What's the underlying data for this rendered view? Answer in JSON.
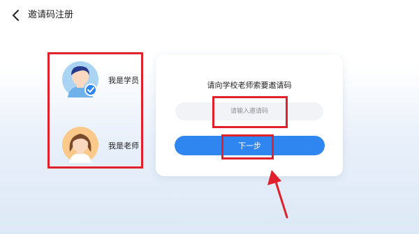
{
  "header": {
    "title": "邀请码注册",
    "back_icon": "chevron-left-icon"
  },
  "roles": [
    {
      "label": "我是学员",
      "selected": true,
      "avatar": "student-avatar",
      "badge_icon": "check-circle-icon"
    },
    {
      "label": "我是老师",
      "selected": false,
      "avatar": "teacher-avatar"
    }
  ],
  "invite": {
    "prompt": "请向学校老师索要邀请码",
    "input_placeholder": "请输入邀请码",
    "input_value": "",
    "next_label": "下一步"
  },
  "annotation": {
    "highlight_color": "#e0202a",
    "arrow_color": "#e0202a",
    "arrow_icon": "arrow-up-icon"
  },
  "colors": {
    "accent": "#2f86f0",
    "input_bg": "#f1f3f7"
  }
}
